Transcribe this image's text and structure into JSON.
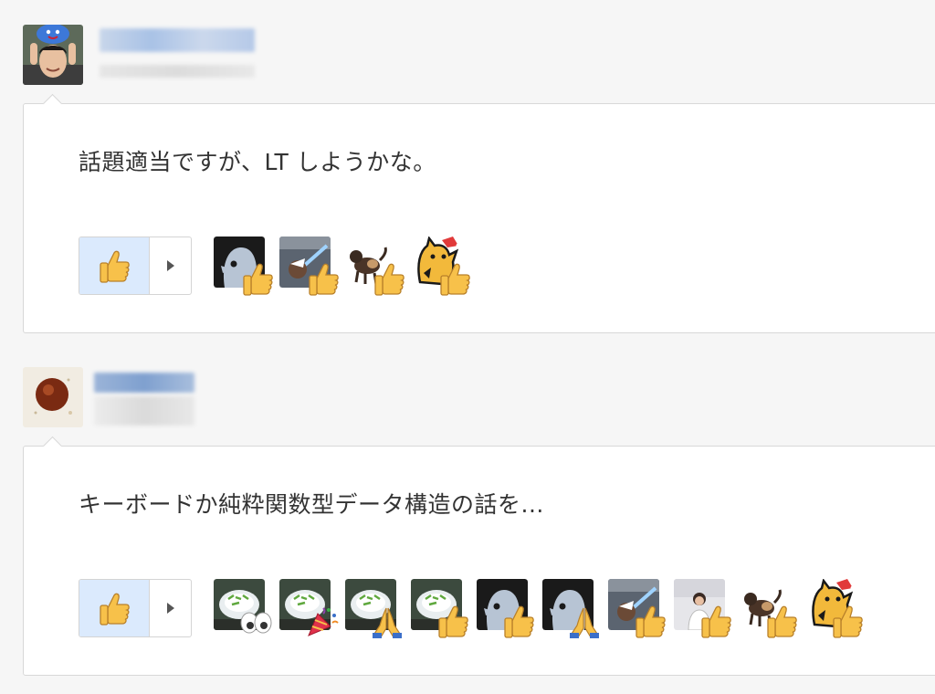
{
  "posts": [
    {
      "message": "話題適当ですが、LT しようかな。",
      "main_reaction_icon": "thumbs-up-icon",
      "reactors": [
        {
          "avatar": "penguin-avatar",
          "reaction": "thumbs-up-icon"
        },
        {
          "avatar": "lightsaber-avatar",
          "reaction": "thumbs-up-icon"
        },
        {
          "avatar": "dog-avatar",
          "reaction": "thumbs-up-icon"
        },
        {
          "avatar": "cat-avatar",
          "reaction": "thumbs-up-icon"
        }
      ]
    },
    {
      "message": "キーボードか純粋関数型データ構造の話を...",
      "main_reaction_icon": "thumbs-up-icon",
      "reactors": [
        {
          "avatar": "food-bowl-avatar",
          "reaction": "eyes-icon"
        },
        {
          "avatar": "food-bowl-avatar",
          "reaction": "party-popper-icon"
        },
        {
          "avatar": "food-bowl-avatar",
          "reaction": "praying-hands-icon"
        },
        {
          "avatar": "food-bowl-avatar",
          "reaction": "thumbs-up-icon"
        },
        {
          "avatar": "penguin-avatar",
          "reaction": "thumbs-up-icon"
        },
        {
          "avatar": "penguin-avatar",
          "reaction": "praying-hands-icon"
        },
        {
          "avatar": "lightsaber-avatar",
          "reaction": "thumbs-up-icon"
        },
        {
          "avatar": "person-avatar",
          "reaction": "thumbs-up-icon"
        },
        {
          "avatar": "dog-avatar",
          "reaction": "thumbs-up-icon"
        },
        {
          "avatar": "cat-avatar",
          "reaction": "thumbs-up-icon"
        }
      ]
    }
  ],
  "colors": {
    "background": "#f6f6f6",
    "card": "#ffffff",
    "border": "#d8d8d8",
    "reaction_selected": "#dbeafd",
    "thumb": "#f7c14a",
    "text": "#333333"
  }
}
